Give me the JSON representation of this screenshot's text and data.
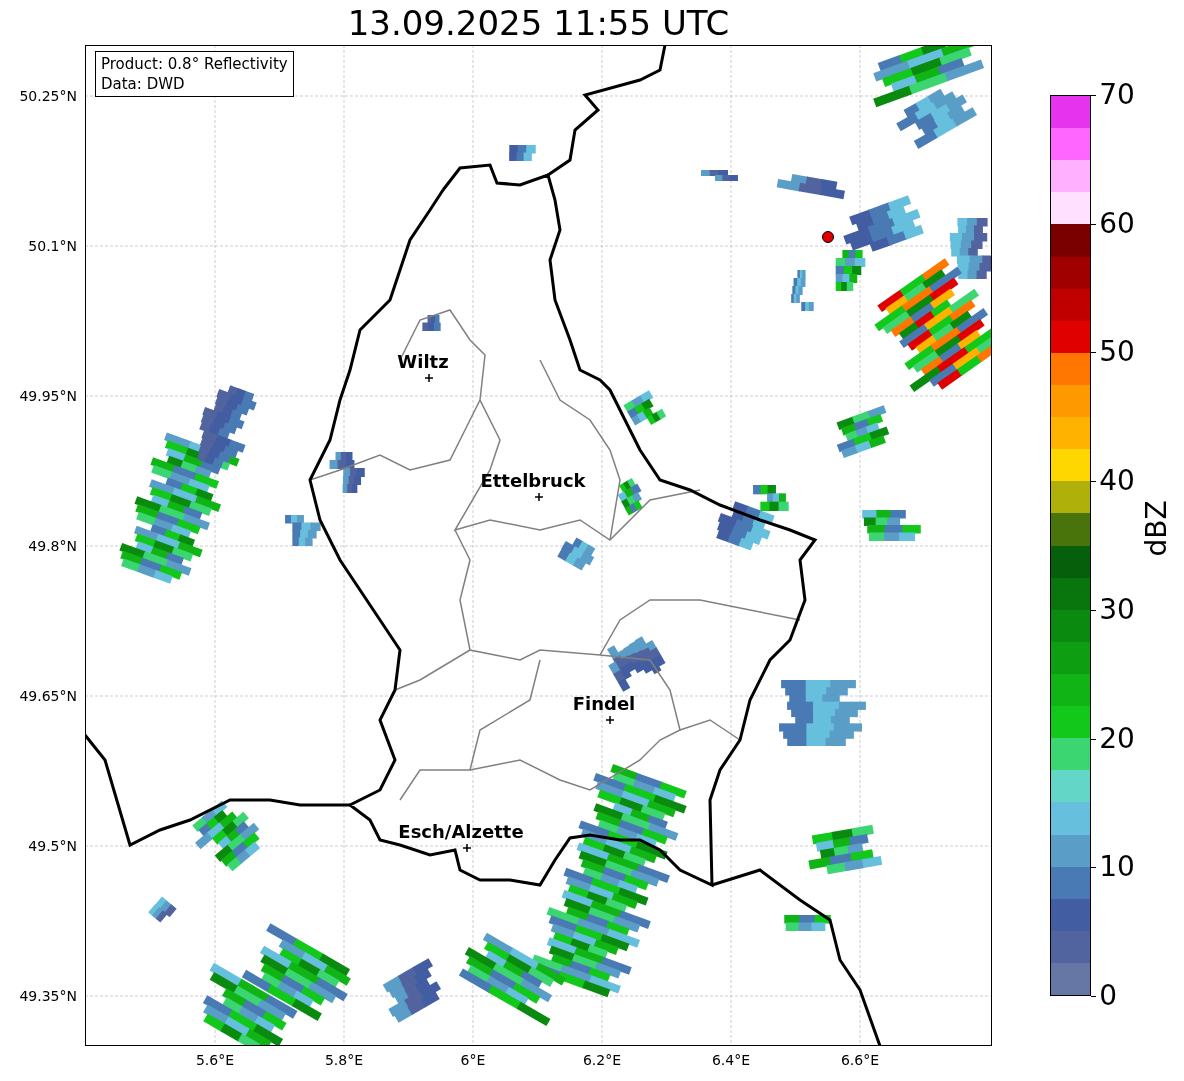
{
  "title": "13.09.2025 11:55 UTC",
  "info_box": {
    "lines": [
      "Product: 0.8° Reflectivity",
      "Data: DWD"
    ]
  },
  "map": {
    "lat_ticks": [
      "50.25°N",
      "50.1°N",
      "49.95°N",
      "49.8°N",
      "49.65°N",
      "49.5°N",
      "49.35°N"
    ],
    "lon_ticks": [
      "5.6°E",
      "5.8°E",
      "6°E",
      "6.2°E",
      "6.4°E",
      "6.6°E"
    ],
    "cities": [
      {
        "name": "Wiltz"
      },
      {
        "name": "Ettelbruck"
      },
      {
        "name": "Findel"
      },
      {
        "name": "Esch/Alzette"
      }
    ]
  },
  "colorbar": {
    "label": "dBZ",
    "ticks": [
      "70",
      "60",
      "50",
      "40",
      "30",
      "20",
      "10",
      "0"
    ],
    "bins": [
      {
        "color": "#e633ee"
      },
      {
        "color": "#ff66ff"
      },
      {
        "color": "#ffb0ff"
      },
      {
        "color": "#ffe0ff"
      },
      {
        "color": "#7a0000"
      },
      {
        "color": "#a00000"
      },
      {
        "color": "#c00000"
      },
      {
        "color": "#e00000"
      },
      {
        "color": "#ff7700"
      },
      {
        "color": "#ff9900"
      },
      {
        "color": "#ffb300"
      },
      {
        "color": "#ffd700"
      },
      {
        "color": "#b0b00a"
      },
      {
        "color": "#48740b"
      },
      {
        "color": "#065f0a"
      },
      {
        "color": "#08760c"
      },
      {
        "color": "#0b8a10"
      },
      {
        "color": "#0e9e12"
      },
      {
        "color": "#10b414"
      },
      {
        "color": "#12c81a"
      },
      {
        "color": "#3bd672"
      },
      {
        "color": "#63d6c8"
      },
      {
        "color": "#66c0dd"
      },
      {
        "color": "#5a9dc7"
      },
      {
        "color": "#4a7ab4"
      },
      {
        "color": "#425da1"
      },
      {
        "color": "#51649f"
      },
      {
        "color": "#6677a6"
      }
    ]
  }
}
